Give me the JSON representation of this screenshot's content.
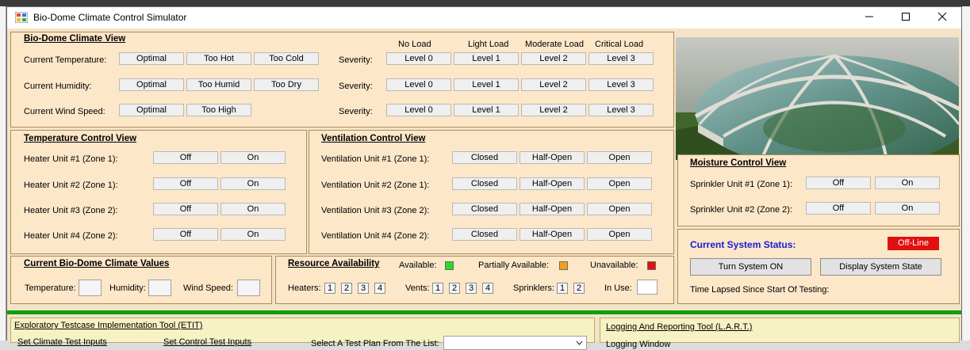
{
  "window": {
    "title": "Bio-Dome Climate Control Simulator"
  },
  "climate_view": {
    "title": "Bio-Dome Climate View",
    "load_headers": [
      "No Load",
      "Light Load",
      "Moderate Load",
      "Critical Load"
    ],
    "rows": [
      {
        "label": "Current Temperature:",
        "options": [
          "Optimal",
          "Too Hot",
          "Too Cold"
        ],
        "severity_label": "Severity:",
        "levels": [
          "Level 0",
          "Level 1",
          "Level 2",
          "Level 3"
        ]
      },
      {
        "label": "Current Humidity:",
        "options": [
          "Optimal",
          "Too Humid",
          "Too Dry"
        ],
        "severity_label": "Severity:",
        "levels": [
          "Level 0",
          "Level 1",
          "Level 2",
          "Level 3"
        ]
      },
      {
        "label": "Current Wind Speed:",
        "options": [
          "Optimal",
          "Too High"
        ],
        "severity_label": "Severity:",
        "levels": [
          "Level 0",
          "Level 1",
          "Level 2",
          "Level 3"
        ]
      }
    ]
  },
  "temperature_control": {
    "title": "Temperature Control View",
    "units": [
      {
        "label": "Heater Unit #1 (Zone 1):",
        "states": [
          "Off",
          "On"
        ]
      },
      {
        "label": "Heater Unit #2 (Zone 1):",
        "states": [
          "Off",
          "On"
        ]
      },
      {
        "label": "Heater Unit #3 (Zone 2):",
        "states": [
          "Off",
          "On"
        ]
      },
      {
        "label": "Heater Unit #4 (Zone 2):",
        "states": [
          "Off",
          "On"
        ]
      }
    ]
  },
  "ventilation_control": {
    "title": "Ventilation Control View",
    "units": [
      {
        "label": "Ventilation Unit #1 (Zone 1):",
        "states": [
          "Closed",
          "Half-Open",
          "Open"
        ]
      },
      {
        "label": "Ventilation Unit #2 (Zone 1):",
        "states": [
          "Closed",
          "Half-Open",
          "Open"
        ]
      },
      {
        "label": "Ventilation Unit #3 (Zone 2):",
        "states": [
          "Closed",
          "Half-Open",
          "Open"
        ]
      },
      {
        "label": "Ventilation Unit #4 (Zone 2):",
        "states": [
          "Closed",
          "Half-Open",
          "Open"
        ]
      }
    ]
  },
  "moisture_control": {
    "title": "Moisture Control View",
    "units": [
      {
        "label": "Sprinkler Unit #1 (Zone 1):",
        "states": [
          "Off",
          "On"
        ]
      },
      {
        "label": "Sprinkler Unit #2 (Zone 2):",
        "states": [
          "Off",
          "On"
        ]
      }
    ]
  },
  "climate_values": {
    "title": "Current Bio-Dome Climate Values",
    "temperature_label": "Temperature:",
    "humidity_label": "Humidity:",
    "wind_label": "Wind Speed:"
  },
  "resources": {
    "title": "Resource Availability",
    "legend": [
      {
        "label": "Available:",
        "color": "#22dd22"
      },
      {
        "label": "Partially Available:",
        "color": "#f0a020"
      },
      {
        "label": "Unavailable:",
        "color": "#e01010"
      }
    ],
    "heaters_label": "Heaters:",
    "vents_label": "Vents:",
    "sprinklers_label": "Sprinklers:",
    "in_use_label": "In Use:",
    "heaters": [
      "1",
      "2",
      "3",
      "4"
    ],
    "vents": [
      "1",
      "2",
      "3",
      "4"
    ],
    "sprinklers": [
      "1",
      "2"
    ]
  },
  "system_status": {
    "title": "Current System Status:",
    "status": "Off-Line",
    "status_color": "#e01010",
    "turn_on_button": "Turn System ON",
    "display_button": "Display System State",
    "time_lapsed_label": "Time Lapsed Since Start Of Testing:"
  },
  "etit": {
    "title": "Exploratory Testcase Implementation Tool (ETIT)",
    "climate_inputs": "Set Climate Test Inputs",
    "control_inputs": "Set Control Test Inputs",
    "test_plan_label": "Select A Test Plan From The List:"
  },
  "lart": {
    "title": "Logging And Reporting Tool (L.A.R.T.)",
    "logging_window": "Logging Window"
  }
}
